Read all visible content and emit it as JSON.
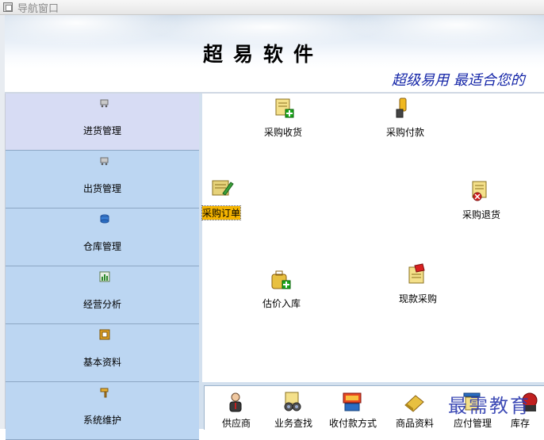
{
  "window": {
    "title": "导航窗口"
  },
  "banner": {
    "heading": "超易软件",
    "slogan": "超级易用  最适合您的"
  },
  "sidebar": {
    "items": [
      {
        "label": "进货管理",
        "icon": "cart-icon",
        "active": true
      },
      {
        "label": "出货管理",
        "icon": "cart-icon",
        "active": false
      },
      {
        "label": "仓库管理",
        "icon": "database-icon",
        "active": false
      },
      {
        "label": "经营分析",
        "icon": "bar-chart-icon",
        "active": false
      },
      {
        "label": "基本资料",
        "icon": "folder-icon",
        "active": false
      },
      {
        "label": "系统维护",
        "icon": "hammer-icon",
        "active": false
      }
    ]
  },
  "desktop": {
    "items": [
      {
        "label": "采购收货",
        "icon": "document-add-icon"
      },
      {
        "label": "采购付款",
        "icon": "hand-pay-icon"
      },
      {
        "label": "采购订单",
        "icon": "order-pencil-icon",
        "selected": true
      },
      {
        "label": "采购退货",
        "icon": "document-remove-icon"
      },
      {
        "label": "估价入库",
        "icon": "bag-add-icon"
      },
      {
        "label": "现款采购",
        "icon": "cash-document-icon"
      }
    ]
  },
  "toolbar": {
    "items": [
      {
        "label": "供应商",
        "icon": "person-icon"
      },
      {
        "label": "业务查找",
        "icon": "binoculars-icon"
      },
      {
        "label": "收付款方式",
        "icon": "payment-method-icon"
      },
      {
        "label": "商品资料",
        "icon": "goods-icon"
      },
      {
        "label": "应付管理",
        "icon": "payable-icon"
      },
      {
        "label": "库存",
        "icon": "inventory-icon"
      }
    ]
  },
  "watermark": "最需教育"
}
